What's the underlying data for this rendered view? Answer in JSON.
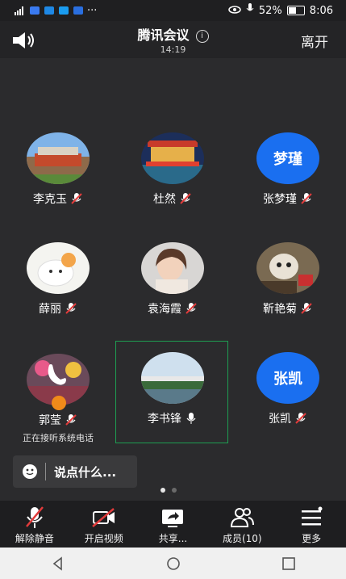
{
  "status": {
    "battery": "52%",
    "time": "8:06",
    "signal_label": "4G"
  },
  "header": {
    "title": "腾讯会议",
    "time": "14:19",
    "leave": "离开"
  },
  "participants": [
    {
      "name": "李克玉",
      "muted": true,
      "avatar": "photo"
    },
    {
      "name": "杜然",
      "muted": true,
      "avatar": "photo"
    },
    {
      "name": "张梦瑾",
      "muted": true,
      "avatar_text": "梦瑾"
    },
    {
      "name": "薛丽",
      "muted": true,
      "avatar": "photo"
    },
    {
      "name": "袁海霞",
      "muted": true,
      "avatar": "photo"
    },
    {
      "name": "靳艳菊",
      "muted": true,
      "avatar": "photo"
    },
    {
      "name": "郭莹",
      "muted": true,
      "avatar": "photo",
      "subtitle": "正在接听系统电话"
    },
    {
      "name": "李书锋",
      "muted": false,
      "avatar": "photo",
      "active_speaker": true
    },
    {
      "name": "张凯",
      "muted": true,
      "avatar_text": "张凯"
    }
  ],
  "chat": {
    "placeholder": "说点什么..."
  },
  "toolbar": {
    "unmute": "解除静音",
    "video": "开启视频",
    "share": "共享...",
    "members": "成员(10)",
    "more": "更多"
  },
  "colors": {
    "accent": "#1a6ff0",
    "active_border": "#1e9e52",
    "muted_red": "#e23b3b"
  }
}
